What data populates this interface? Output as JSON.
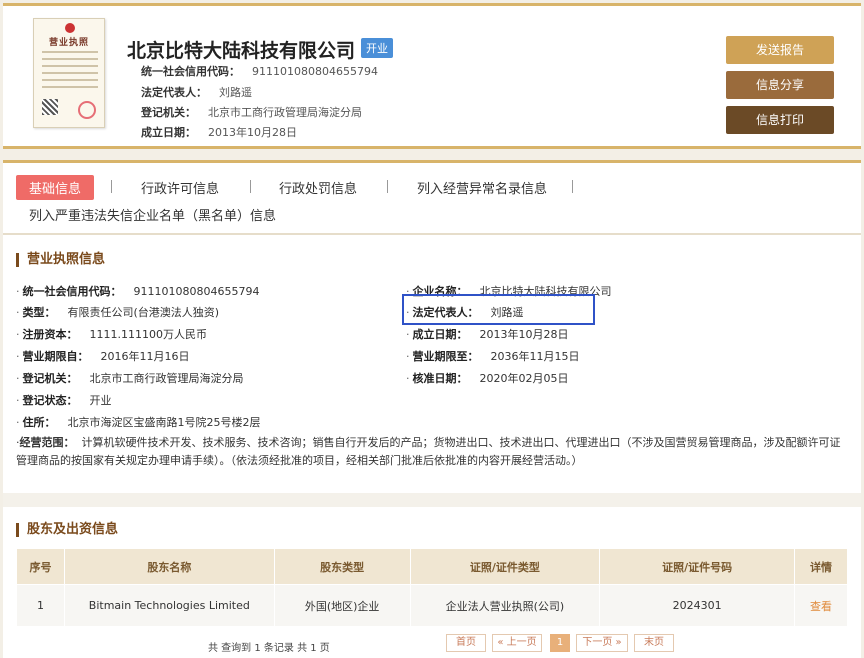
{
  "header": {
    "license_image": {
      "title": "营业执照"
    },
    "company_name": "北京比特大陆科技有限公司",
    "status_badge": "开业",
    "fields": [
      {
        "label": "统一社会信用代码：",
        "value": "911101080804655794"
      },
      {
        "label": "法定代表人：",
        "value": "刘路遥"
      },
      {
        "label": "登记机关：",
        "value": "北京市工商行政管理局海淀分局"
      },
      {
        "label": "成立日期：",
        "value": "2013年10月28日"
      }
    ],
    "buttons": {
      "report": "发送报告",
      "share": "信息分享",
      "print": "信息打印"
    }
  },
  "tabs": [
    {
      "label": "基础信息",
      "active": true
    },
    {
      "label": "行政许可信息",
      "active": false
    },
    {
      "label": "行政处罚信息",
      "active": false
    },
    {
      "label": "列入经营异常名录信息",
      "active": false
    },
    {
      "label": "列入严重违法失信企业名单（黑名单）信息",
      "active": false
    }
  ],
  "license_section": {
    "title": "营业执照信息",
    "left": [
      {
        "label": "统一社会信用代码：",
        "value": "911101080804655794"
      },
      {
        "label": "类型：",
        "value": "有限责任公司(台港澳法人独资)"
      },
      {
        "label": "注册资本：",
        "value": "1111.111100万人民币"
      },
      {
        "label": "营业期限自：",
        "value": "2016年11月16日"
      },
      {
        "label": "登记机关：",
        "value": "北京市工商行政管理局海淀分局"
      },
      {
        "label": "登记状态：",
        "value": "开业"
      },
      {
        "label": "住所：",
        "value": "北京市海淀区宝盛南路1号院25号楼2层"
      }
    ],
    "right": [
      {
        "label": "企业名称：",
        "value": "北京比特大陆科技有限公司"
      },
      {
        "label": "法定代表人：",
        "value": "刘路遥"
      },
      {
        "label": "成立日期：",
        "value": "2013年10月28日"
      },
      {
        "label": "营业期限至：",
        "value": "2036年11月15日"
      },
      {
        "label": "核准日期：",
        "value": "2020年02月05日"
      }
    ],
    "scope_label": "经营范围：",
    "scope_text": "计算机软硬件技术开发、技术服务、技术咨询；销售自行开发后的产品；货物进出口、技术进出口、代理进出口（不涉及国营贸易管理商品，涉及配额许可证管理商品的按国家有关规定办理申请手续）。（依法须经批准的项目，经相关部门批准后依批准的内容开展经营活动。）"
  },
  "shareholder_section": {
    "title": "股东及出资信息",
    "columns": [
      "序号",
      "股东名称",
      "股东类型",
      "证照/证件类型",
      "证照/证件号码",
      "详情"
    ],
    "rows": [
      [
        "1",
        "Bitmain Technologies Limited",
        "外国(地区)企业",
        "企业法人营业执照(公司)",
        "2024301",
        "查看"
      ]
    ]
  },
  "pagination": {
    "summary": "共 查询到 1 条记录 共 1 页",
    "first": "首页",
    "prev": "« 上一页",
    "current": "1",
    "next": "下一页 »",
    "last": "末页"
  },
  "colors": {
    "accent": "#d8b46a",
    "active_tab": "#ef6b67",
    "badge": "#4a8fd8",
    "highlight": "#2f52c7"
  }
}
